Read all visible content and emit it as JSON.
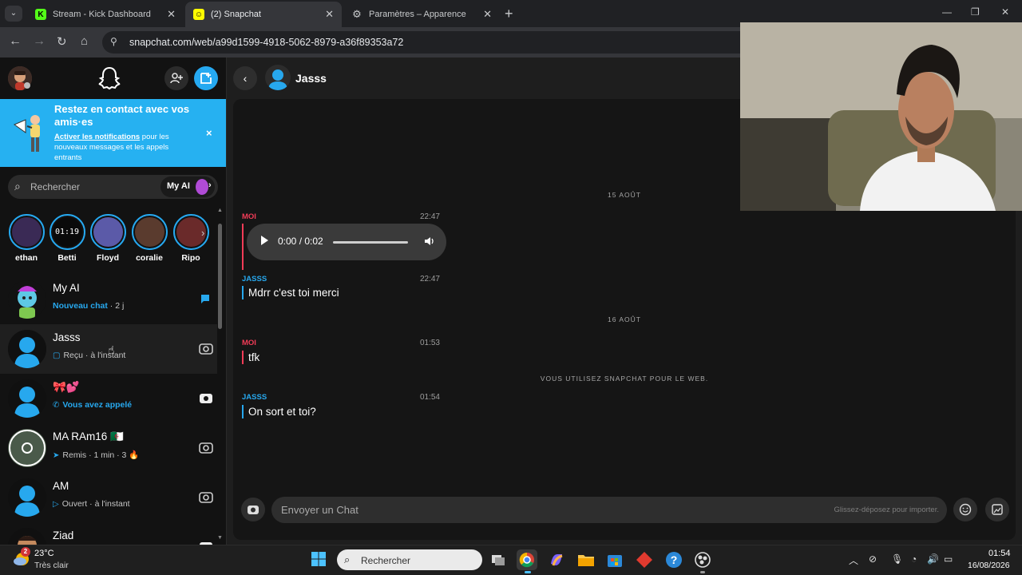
{
  "browser": {
    "tabs": [
      {
        "title": "Stream - Kick Dashboard",
        "favicon": "kick-icon",
        "active": false
      },
      {
        "title": "(2) Snapchat",
        "favicon": "snapchat-icon",
        "active": true
      },
      {
        "title": "Paramètres – Apparence",
        "favicon": "gear-icon",
        "active": false
      }
    ],
    "url": "snapchat.com/web/a99d1599-4918-5062-8979-a36f89353a72"
  },
  "sidebar": {
    "banner": {
      "title": "Restez en contact avec vos amis·es",
      "link": "Activer les notifications",
      "body": " pour les nouveaux messages et les appels entrants",
      "close": "×"
    },
    "search_placeholder": "Rechercher",
    "myai_label": "My AI",
    "stories": [
      {
        "name": "ethan",
        "color": "#3a2a55"
      },
      {
        "name": "Betti",
        "color": "#0a0a0a"
      },
      {
        "name": "Floyd",
        "color": "#5b5aa8"
      },
      {
        "name": "coralie",
        "color": "#5a3b2e"
      },
      {
        "name": "Ripo",
        "color": "#6a2a2a"
      }
    ],
    "chats": [
      {
        "name": "My AI",
        "status": "Nouveau chat",
        "time": "2 j",
        "status_icon": "",
        "status_color": "#27a8ee"
      },
      {
        "name": "Jasss",
        "status": "Reçu",
        "time": "à l'instant",
        "status_icon": "▢",
        "status_color": "#c6c6c6"
      },
      {
        "name": "🎀💕",
        "status": "Vous avez appelé",
        "time": "",
        "status_icon": "✆",
        "status_color": "#27a8ee"
      },
      {
        "name": "MA RAm16 🇩🇿",
        "status": "Remis",
        "time": "1 min",
        "streak": "3 🔥",
        "status_icon": "➤",
        "status_color": "#c6c6c6"
      },
      {
        "name": "AM",
        "status": "Ouvert",
        "time": "à l'instant",
        "status_icon": "▷",
        "status_color": "#c6c6c6"
      },
      {
        "name": "Ziad",
        "status": "",
        "time": "",
        "status_icon": "",
        "status_color": "#c6c6c6"
      }
    ]
  },
  "chat": {
    "contact": "Jasss",
    "dates": [
      "15 AOÛT",
      "16 AOÛT"
    ],
    "messages": [
      {
        "sender": "MOI",
        "time": "22:47",
        "audio": "0:00 / 0:02"
      },
      {
        "sender": "JASSS",
        "time": "22:47",
        "text": "Mdrr c'est toi merci"
      },
      {
        "sender": "MOI",
        "time": "01:53",
        "text": "tfk"
      },
      {
        "sender": "JASSS",
        "time": "01:54",
        "text": "On sort et toi?"
      }
    ],
    "system_notice": "VOUS UTILISEZ SNAPCHAT POUR LE WEB.",
    "composer_placeholder": "Envoyer un Chat",
    "composer_hint": "Glissez-déposez pour importer."
  },
  "taskbar": {
    "temperature": "23°C",
    "weather": "Très clair",
    "weather_badge": "2",
    "search_placeholder": "Rechercher",
    "time": "01:54",
    "date": "16/08/2026"
  },
  "colors": {
    "snap_blue": "#26b1f1",
    "me_red": "#f23c57",
    "friend_blue": "#27a8ee"
  }
}
